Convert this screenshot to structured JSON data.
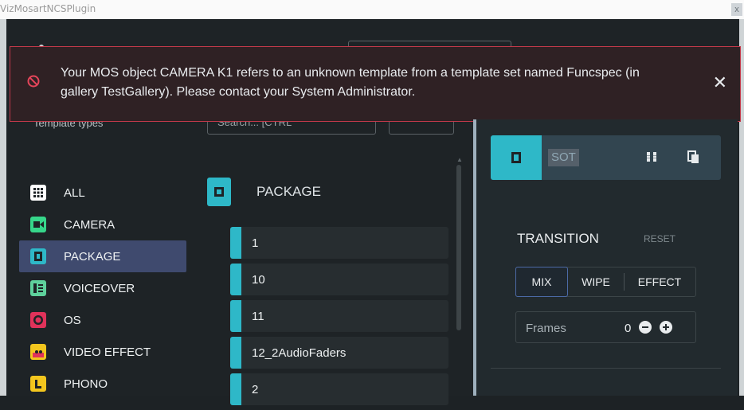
{
  "window": {
    "title": "VizMosartNCSPlugin",
    "close_glyph": "x"
  },
  "alert": {
    "message": "Your MOS object CAMERA K1 refers to an unknown template from a template set named Funcspec (in gallery TestGallery). Please contact your System Administrator.",
    "color": "#c2394a"
  },
  "filters": {
    "template_types_label": "Template types",
    "search_placeholder": "Search... [CTRL"
  },
  "template_types": [
    {
      "label": "ALL",
      "icon": "grid-icon",
      "color": "#ffffff"
    },
    {
      "label": "CAMERA",
      "icon": "camera-icon",
      "color": "#36d68a"
    },
    {
      "label": "PACKAGE",
      "icon": "film-icon",
      "color": "#2eb8c8"
    },
    {
      "label": "VOICEOVER",
      "icon": "voiceover-icon",
      "color": "#5ed19c"
    },
    {
      "label": "OS",
      "icon": "record-icon",
      "color": "#e0325a"
    },
    {
      "label": "VIDEO EFFECT",
      "icon": "effect-icon",
      "color": "#f3c61e"
    },
    {
      "label": "PHONO",
      "icon": "phone-icon",
      "color": "#f3c61e"
    }
  ],
  "selected_type": "PACKAGE",
  "package_list": {
    "header": "PACKAGE",
    "items": [
      "1",
      "10",
      "11",
      "12_2AudioFaders",
      "2"
    ]
  },
  "right_panel": {
    "card_name": "SOT",
    "transition": {
      "title": "TRANSITION",
      "reset": "RESET",
      "options": [
        "MIX",
        "WIPE",
        "EFFECT"
      ],
      "selected": "MIX"
    },
    "frames": {
      "label": "Frames",
      "value": "0"
    }
  },
  "accent_colors": {
    "teal": "#2eb8c8",
    "selected_bg": "#3f4a6e"
  }
}
